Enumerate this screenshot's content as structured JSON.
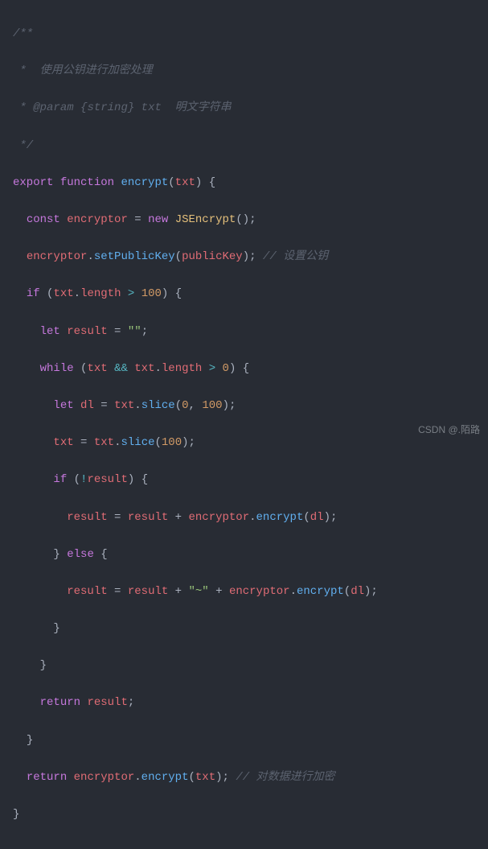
{
  "code": {
    "l1": "/**",
    "l2_prefix": " *  ",
    "l2_text": "使用公钥进行加密处理",
    "l3_prefix": " * ",
    "l3_tag": "@param",
    "l3_type": " {string}",
    "l3_name": " txt",
    "l3_desc": "  明文字符串",
    "l4": " */",
    "l5_export": "export",
    "l5_function": "function",
    "l5_name": "encrypt",
    "l5_param": "txt",
    "l6_const": "const",
    "l6_var": "encryptor",
    "l6_eq": " = ",
    "l6_new": "new",
    "l6_class": "JSEncrypt",
    "l7_obj": "encryptor",
    "l7_method": "setPublicKey",
    "l7_arg": "publicKey",
    "l7_comment": "// 设置公钥",
    "l8_if": "if",
    "l8_obj": "txt",
    "l8_prop": "length",
    "l8_op": ">",
    "l8_num": "100",
    "l9_let": "let",
    "l9_var": "result",
    "l9_eq": " = ",
    "l9_str": "\"\"",
    "l10_while": "while",
    "l10_obj": "txt",
    "l10_and": "&&",
    "l10_obj2": "txt",
    "l10_prop": "length",
    "l10_op": ">",
    "l10_num": "0",
    "l11_let": "let",
    "l11_var": "dl",
    "l11_eq": " = ",
    "l11_obj": "txt",
    "l11_method": "slice",
    "l11_arg1": "0",
    "l11_arg2": "100",
    "l12_obj": "txt",
    "l12_eq": " = ",
    "l12_obj2": "txt",
    "l12_method": "slice",
    "l12_arg": "100",
    "l13_if": "if",
    "l13_not": "!",
    "l13_var": "result",
    "l14_var": "result",
    "l14_eq": " = ",
    "l14_var2": "result",
    "l14_plus": " + ",
    "l14_obj": "encryptor",
    "l14_method": "encrypt",
    "l14_arg": "dl",
    "l15_else": "else",
    "l16_var": "result",
    "l16_eq": " = ",
    "l16_var2": "result",
    "l16_plus": " + ",
    "l16_str": "\"~\"",
    "l16_plus2": " + ",
    "l16_obj": "encryptor",
    "l16_method": "encrypt",
    "l16_arg": "dl",
    "l19_return": "return",
    "l19_var": "result",
    "l21_return": "return",
    "l21_obj": "encryptor",
    "l21_method": "encrypt",
    "l21_arg": "txt",
    "l21_comment": "// 对数据进行加密"
  },
  "watermark": "CSDN @.陌路"
}
